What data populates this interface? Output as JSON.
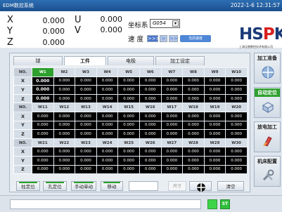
{
  "titlebar": {
    "app": "EDM数控系统",
    "clock": "2022-1-6 12:31:57"
  },
  "coords": {
    "x_label": "X",
    "x_value": "0.000",
    "u_label": "U",
    "u_value": "0.000",
    "y_label": "Y",
    "y_value": "0.000",
    "v_label": "V",
    "v_value": "0.000",
    "z_label": "Z",
    "z_value": "0.000",
    "cs_label": "坐标系",
    "cs_value": "G054",
    "speed_label": "速 度",
    "speed_buttons": [
      ">>>",
      ">",
      ">>"
    ],
    "speed_note": "当前速度"
  },
  "logo": {
    "brand_main": "HS",
    "brand_p": "P",
    "brand_k": "K",
    "tagline": "上海汉普数控技术有限公司"
  },
  "tabs": [
    "球",
    "工件",
    "电极",
    "加工设定"
  ],
  "active_tab": 1,
  "grid": {
    "groups": [
      {
        "headers": [
          "NO.",
          "W1",
          "W2",
          "W3",
          "W4",
          "W5",
          "W6",
          "W7",
          "W8",
          "W9",
          "W10"
        ]
      },
      {
        "headers": [
          "NO.",
          "W11",
          "W12",
          "W13",
          "W14",
          "W15",
          "W16",
          "W17",
          "W18",
          "W19",
          "W20"
        ]
      },
      {
        "headers": [
          "NO.",
          "W21",
          "W22",
          "W23",
          "W24",
          "W25",
          "W26",
          "W27",
          "W28",
          "W29",
          "W30"
        ]
      }
    ],
    "axes": [
      "X",
      "Y",
      "Z"
    ],
    "cell_value": "0.000"
  },
  "buttons": {
    "edge": "柱定位",
    "hole": "孔定位",
    "manual": "手动单动",
    "move": "移动",
    "size": "尺寸",
    "clear": "清空"
  },
  "side": [
    "加工准备",
    "自动定位",
    "放电加工",
    "机床配置"
  ],
  "status": {
    "st": "ST"
  },
  "colors": {
    "accent_green": "#2ea02e",
    "title_blue": "#2d6fb4",
    "logo_navy": "#1a3a78",
    "logo_red": "#d92020"
  }
}
